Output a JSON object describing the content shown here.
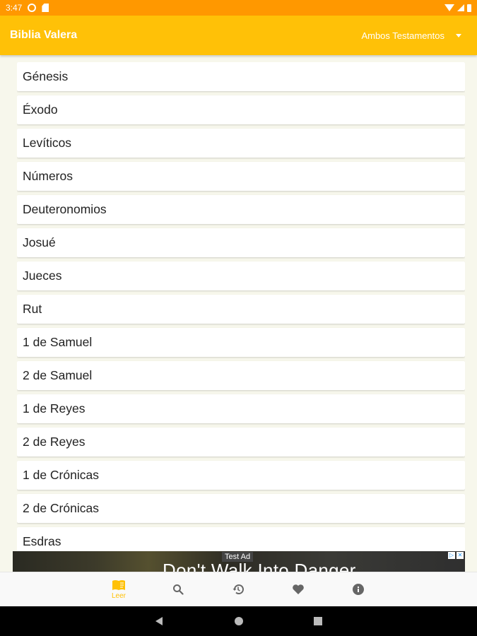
{
  "status_bar": {
    "time": "3:47"
  },
  "app_bar": {
    "title": "Biblia Valera",
    "testament_selected": "Ambos Testamentos"
  },
  "books": [
    "Génesis",
    "Éxodo",
    "Levíticos",
    "Números",
    "Deuteronomios",
    "Josué",
    "Jueces",
    "Rut",
    "1 de Samuel",
    "2 de Samuel",
    "1 de Reyes",
    "2 de Reyes",
    "1 de Crónicas",
    "2 de Crónicas",
    "Esdras"
  ],
  "ad": {
    "label": "Test Ad",
    "headline": "Don't Walk Into Danger"
  },
  "bottom_nav": {
    "read_label": "Leer",
    "items": [
      "book-open-icon",
      "search-icon",
      "history-icon",
      "heart-icon",
      "info-icon"
    ]
  },
  "colors": {
    "primary": "#ffc107",
    "status_bar": "#ff9800",
    "background": "#f7f7ec"
  }
}
